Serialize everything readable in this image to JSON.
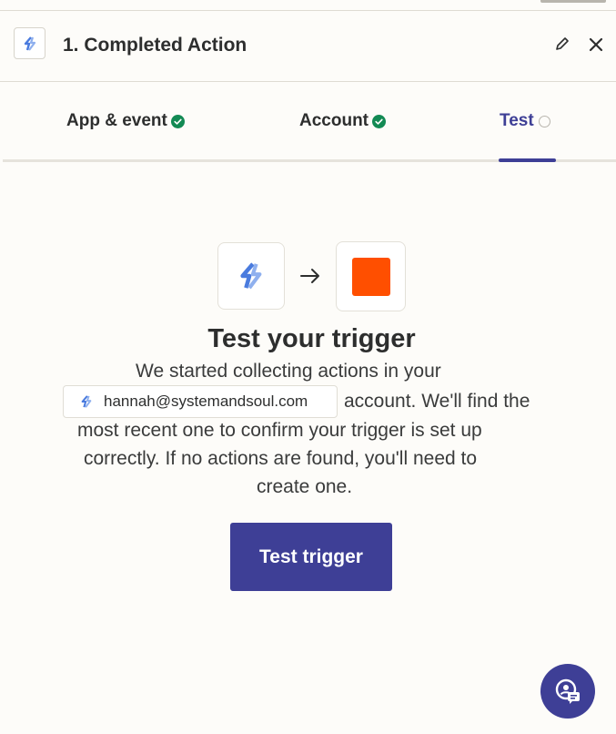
{
  "header": {
    "title": "1. Completed Action",
    "icons": {
      "app": "app-logo-icon",
      "edit": "pencil-icon",
      "close": "close-icon"
    }
  },
  "tabs": [
    {
      "label": "App & event",
      "status": "complete"
    },
    {
      "label": "Account",
      "status": "complete"
    },
    {
      "label": "Test",
      "status": "active"
    }
  ],
  "main": {
    "heading": "Test your trigger",
    "line1": "We started collecting actions in your",
    "account_chip": "hannah@systemandsoul.com",
    "line2_suffix": "account. We'll find the",
    "line3": "most recent one to confirm your trigger is set up",
    "line4": "correctly. If no actions are found, you'll need to",
    "line5": "create one.",
    "button": "Test trigger"
  },
  "colors": {
    "accent": "#3e3f96",
    "success": "#138a54",
    "target_app": "#ff4f00",
    "app_blue": "#4a7bde"
  }
}
